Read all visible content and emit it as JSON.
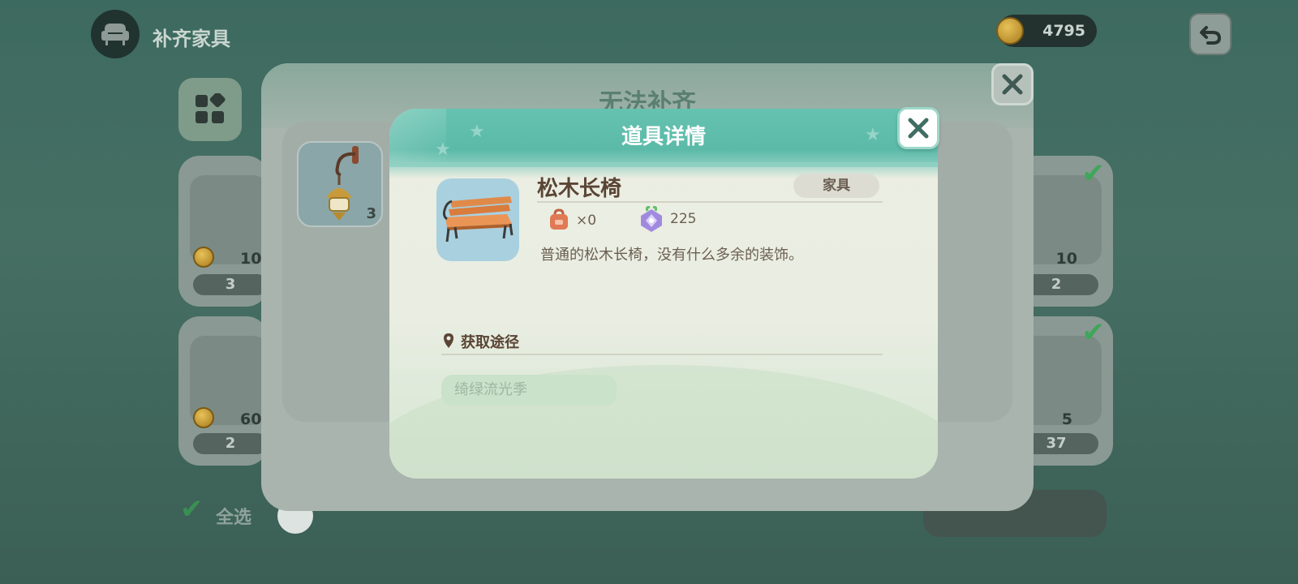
{
  "header": {
    "title": "补齐家具",
    "coin_amount": "4795"
  },
  "background": {
    "card_prices": [
      "10",
      "60",
      "10",
      "5"
    ],
    "card_counts": [
      "3",
      "2",
      "2",
      "37"
    ],
    "select_all_label": "全选"
  },
  "mid_dialog": {
    "title": "无法补齐",
    "lamp_count": "3"
  },
  "detail_dialog": {
    "title": "道具详情",
    "item_name": "松木长椅",
    "item_tag": "家具",
    "owned": "×0",
    "value": "225",
    "description": "普通的松木长椅，没有什么多余的装饰。",
    "source_title": "获取途径",
    "source_item": "绮绿流光季"
  },
  "colors": {
    "header_teal": "#5bbaa8",
    "dialog_bg": "#ecede2",
    "text_brown": "#5a4535",
    "coin_gold": "#e8c25a"
  }
}
